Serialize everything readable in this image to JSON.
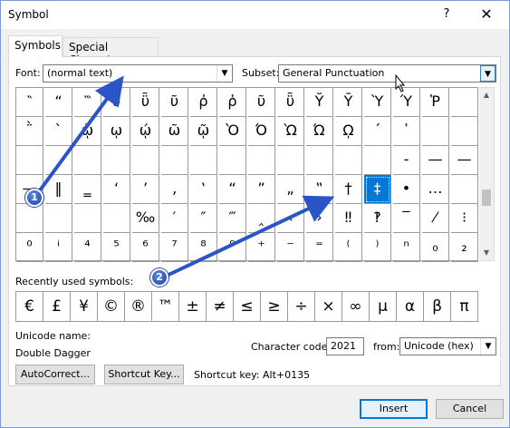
{
  "window": {
    "title": "Symbol",
    "help": "?",
    "close": "✕"
  },
  "tabs": {
    "symbols": "Symbols",
    "special": "Special Characters"
  },
  "font": {
    "label": "Font:",
    "value": "(normal text)"
  },
  "subset": {
    "label": "Subset:",
    "value": "General Punctuation"
  },
  "grid": {
    "rows": [
      [
        "‶",
        "“",
        "‷",
        "ῦ",
        "ῧ",
        "ῦ",
        "ῤ",
        "ῥ",
        "ῦ",
        "ῧ",
        "Ῠ",
        "Ῡ",
        "Ὺ",
        "Ύ",
        "Ῥ",
        ""
      ],
      [
        "῭",
        "`",
        "ῲ",
        "ῳ",
        "ῴ",
        "ῶ",
        "ῷ",
        "Ὸ",
        "Ό",
        "Ὼ",
        "Ώ",
        "ῼ",
        "´",
        "῾",
        "",
        ""
      ],
      [
        "",
        "",
        "",
        "",
        "",
        "",
        "",
        "",
        "",
        "",
        "",
        "",
        "",
        "-",
        "—",
        "—"
      ],
      [
        "—",
        "‖",
        "‗",
        "‘",
        "’",
        "‚",
        "‛",
        "“",
        "”",
        "„",
        "‟",
        "†",
        "‡",
        "•",
        "…",
        ""
      ],
      [
        "",
        "",
        "",
        "",
        "‰",
        "′",
        "″",
        "‴",
        "‸",
        "‹",
        "›",
        "‼",
        "‽",
        "‾",
        "⁄",
        "⁝"
      ],
      [
        "⁰",
        "ⁱ",
        "⁴",
        "⁵",
        "⁶",
        "⁷",
        "⁸",
        "⁹",
        "⁺",
        "⁻",
        "⁼",
        "⁽",
        "⁾",
        "ⁿ",
        "₀",
        "₂"
      ]
    ]
  },
  "scroll": {
    "up": "▲",
    "down": "▼"
  },
  "recent": {
    "label": "Recently used symbols:",
    "items": [
      "€",
      "£",
      "¥",
      "©",
      "®",
      "™",
      "±",
      "≠",
      "≤",
      "≥",
      "÷",
      "×",
      "∞",
      "µ",
      "α",
      "β",
      "π"
    ]
  },
  "unicode_name": {
    "label": "Unicode name:",
    "value": "Double Dagger"
  },
  "char_code": {
    "label": "Character code:",
    "value": "2021"
  },
  "from": {
    "label": "from:",
    "value": "Unicode (hex)"
  },
  "buttons": {
    "autocorrect": "AutoCorrect...",
    "shortcut_key": "Shortcut Key...",
    "insert": "Insert",
    "cancel": "Cancel"
  },
  "shortcut": {
    "text": "Shortcut key: Alt+0135"
  },
  "badges": {
    "one": "1",
    "two": "2"
  },
  "colors": {
    "selection": "#0078d7",
    "annotation": "#2a55c8"
  }
}
